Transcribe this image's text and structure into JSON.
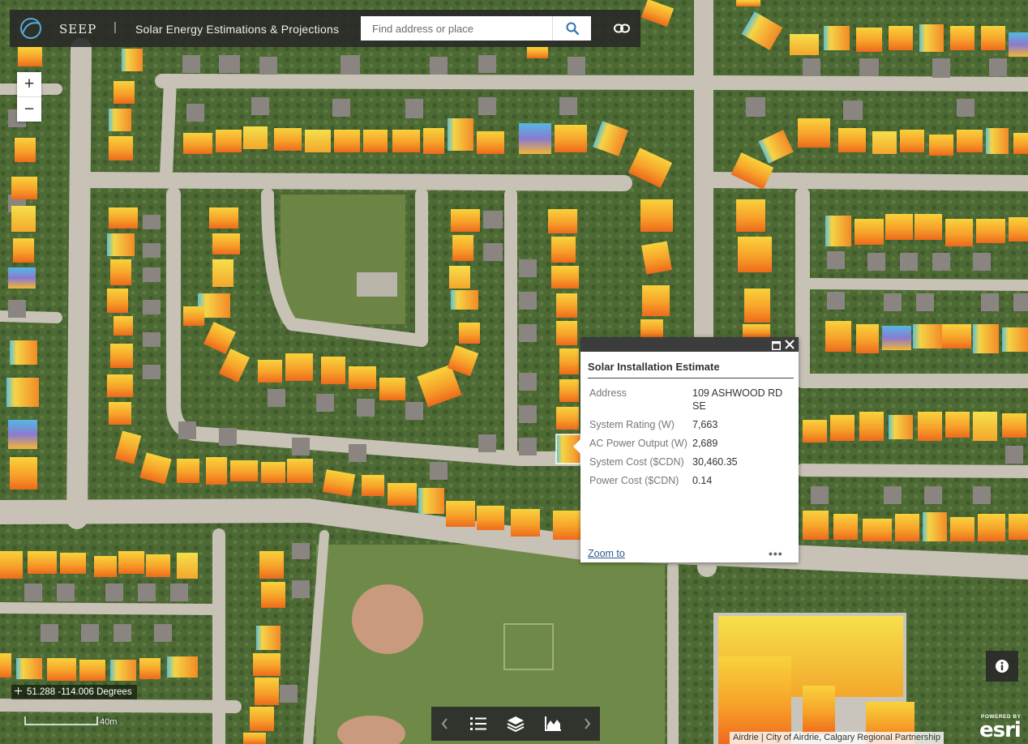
{
  "header": {
    "app_short": "SEEP",
    "separator": "|",
    "app_title": "Solar Energy Estimations & Projections",
    "search_placeholder": "Find address or place"
  },
  "zoom": {
    "in": "+",
    "out": "−"
  },
  "popup": {
    "title": "Solar Installation Estimate",
    "fields": [
      {
        "label": "Address",
        "value": "109 ASHWOOD RD SE"
      },
      {
        "label": "System Rating (W)",
        "value": "7,663"
      },
      {
        "label": "AC Power Output (W)",
        "value": "2,689"
      },
      {
        "label": "System Cost ($CDN)",
        "value": "30,460.35"
      },
      {
        "label": "Power Cost ($CDN)",
        "value": "0.14"
      }
    ],
    "zoom_to": "Zoom to",
    "more": "•••"
  },
  "coordinates": "51.288 -114.006 Degrees",
  "scale_label": "40m",
  "attribution": "Airdrie | City of Airdrie, Calgary Regional Partnership",
  "esri": {
    "powered_by": "POWERED BY",
    "name": "esri"
  },
  "icons": {
    "logo": "seep-logo-icon",
    "search": "search-icon",
    "share": "link-icon",
    "prev": "chevron-left-icon",
    "legend": "legend-list-icon",
    "layers": "layers-icon",
    "chart": "area-chart-icon",
    "next": "chevron-right-icon",
    "info": "info-icon",
    "locate": "crosshair-icon"
  },
  "colors": {
    "header_bg": "#282828",
    "link": "#2f5b8e",
    "solar_high": "#f07a1e",
    "solar_mid": "#f8c03a",
    "solar_low": "#38b4e0"
  }
}
